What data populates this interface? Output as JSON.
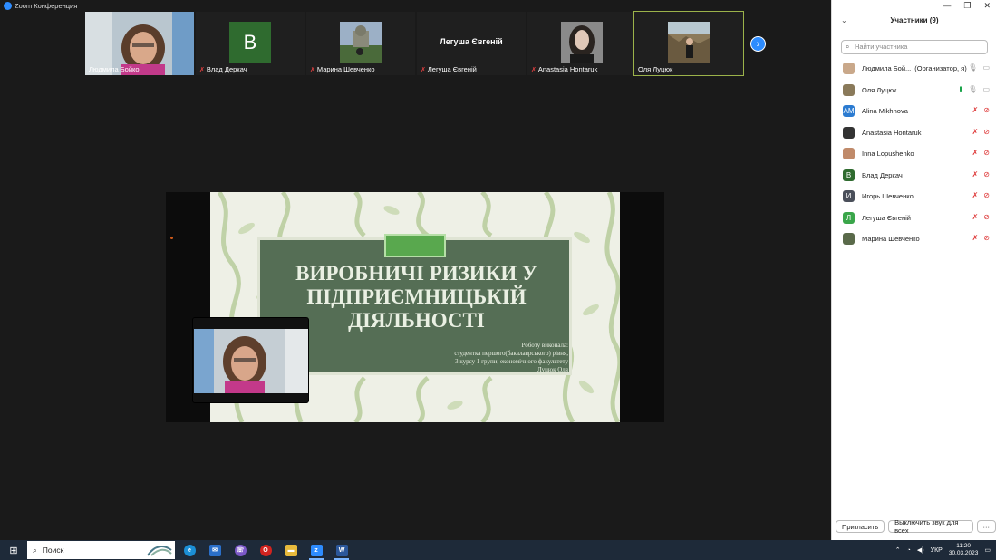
{
  "window": {
    "title": "Zoom Конференция"
  },
  "gallery": {
    "tiles": [
      {
        "name": "Людмила Бойко",
        "muted": false
      },
      {
        "name": "Влад Деркач",
        "initial": "В",
        "muted": true
      },
      {
        "name": "Марина Шевченко",
        "muted": true
      },
      {
        "name": "Легуша Євгеній",
        "center_name": "Легуша Євгеній",
        "muted": true
      },
      {
        "name": "Anastasia Hontaruk",
        "muted": true
      },
      {
        "name": "Оля Луцюк",
        "muted": false,
        "active": true
      }
    ],
    "next_icon": "chevron-right-icon"
  },
  "slide": {
    "title": "ВИРОБНИЧІ РИЗИКИ У ПІДПРИЄМНИЦЬКІЙ ДІЯЛЬНОСТІ",
    "author_lines": [
      "Роботу виконала:",
      "студентка першого(бакалаврського) рівня,",
      "3 курсу 1 групи, економічного факультету",
      "Луцюк Оля"
    ]
  },
  "panel": {
    "title": "Участники (9)",
    "search_placeholder": "Найти участника",
    "participants": [
      {
        "name": "Людмила Бой...",
        "role": "(Организатор, я)",
        "avatar": "photo",
        "color": "#c9a88a",
        "mic": "on",
        "video": "on"
      },
      {
        "name": "Оля Луцюк",
        "role": "",
        "avatar": "photo",
        "color": "#8a7a5a",
        "mic": "on",
        "video": "on",
        "sharing": true
      },
      {
        "name": "Alina Mikhnova",
        "role": "",
        "avatar": "AM",
        "color": "#2b7bd1",
        "mic": "off",
        "video": "off"
      },
      {
        "name": "Anastasia Hontaruk",
        "role": "",
        "avatar": "photo",
        "color": "#333333",
        "mic": "off",
        "video": "off"
      },
      {
        "name": "Inna Lopushenko",
        "role": "",
        "avatar": "photo",
        "color": "#c08a6a",
        "mic": "off",
        "video": "off"
      },
      {
        "name": "Влад Деркач",
        "role": "",
        "avatar": "В",
        "color": "#2f6b2f",
        "mic": "off",
        "video": "off"
      },
      {
        "name": "Игорь Шевченко",
        "role": "",
        "avatar": "И",
        "color": "#4a4f5a",
        "mic": "off",
        "video": "off"
      },
      {
        "name": "Легуша Євгеній",
        "role": "",
        "avatar": "Л",
        "color": "#3aa64a",
        "mic": "off",
        "video": "off"
      },
      {
        "name": "Марина Шевченко",
        "role": "",
        "avatar": "photo",
        "color": "#5a6a4a",
        "mic": "off",
        "video": "off"
      }
    ],
    "invite_label": "Пригласить",
    "mute_all_label": "Выключить звук для всех",
    "more_label": "···"
  },
  "taskbar": {
    "search_label": "Поиск",
    "language": "УКР",
    "time": "11:20",
    "date": "30.03.2023"
  },
  "colors": {
    "zoom_blue": "#2d8cff",
    "slide_green": "#556e55",
    "mute_red": "#e04040"
  }
}
